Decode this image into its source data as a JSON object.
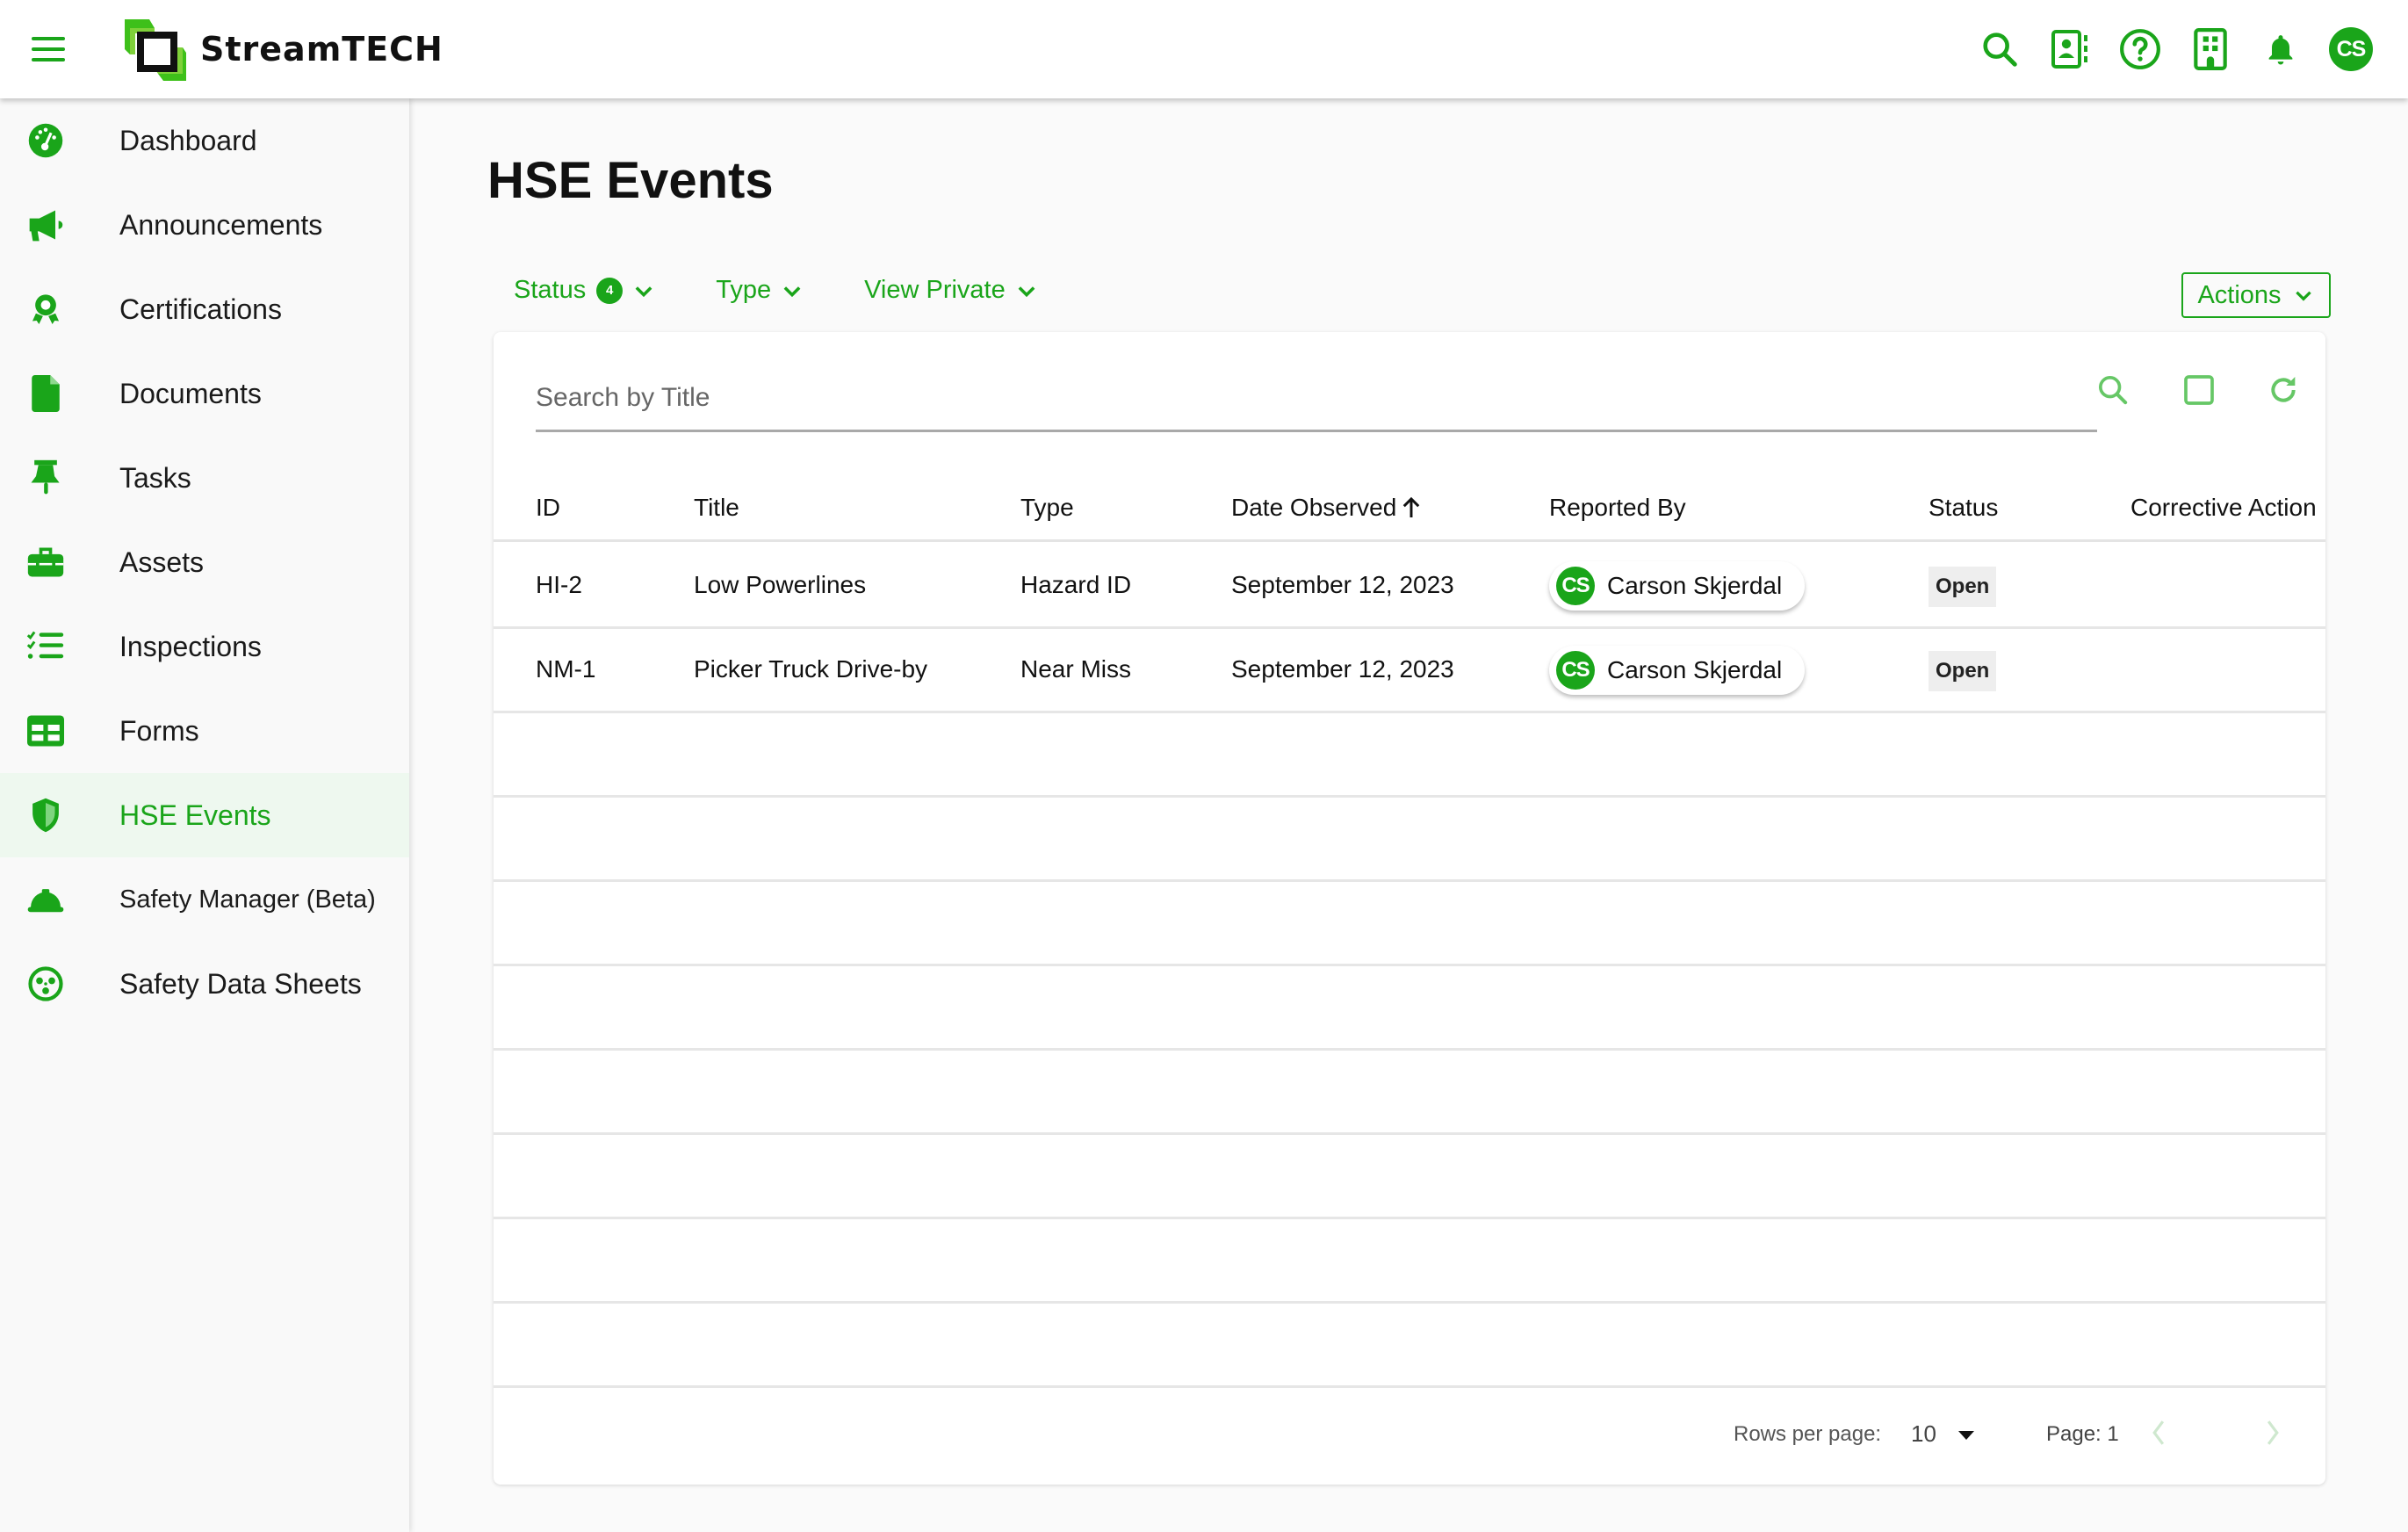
{
  "app": {
    "brand": "StreamTECH",
    "brand_color": "#1aa51a",
    "top_icons": [
      "search-icon",
      "contacts-icon",
      "help-icon",
      "building-icon",
      "bell-icon"
    ],
    "user_initials": "CS"
  },
  "sidebar": {
    "items": [
      {
        "label": "Dashboard",
        "icon": "dashboard-icon",
        "active": false
      },
      {
        "label": "Announcements",
        "icon": "megaphone-icon",
        "active": false
      },
      {
        "label": "Certifications",
        "icon": "award-icon",
        "active": false
      },
      {
        "label": "Documents",
        "icon": "document-icon",
        "active": false
      },
      {
        "label": "Tasks",
        "icon": "pin-icon",
        "active": false
      },
      {
        "label": "Assets",
        "icon": "toolbox-icon",
        "active": false
      },
      {
        "label": "Inspections",
        "icon": "checklist-icon",
        "active": false
      },
      {
        "label": "Forms",
        "icon": "table-icon",
        "active": false
      },
      {
        "label": "HSE Events",
        "icon": "shield-icon",
        "active": true
      },
      {
        "label": "Safety Manager (Beta)",
        "icon": "hardhat-icon",
        "active": false
      },
      {
        "label": "Safety Data Sheets",
        "icon": "biohazard-icon",
        "active": false
      }
    ]
  },
  "main": {
    "title": "HSE Events",
    "filters": {
      "status_label": "Status",
      "status_count": "4",
      "type_label": "Type",
      "private_label": "View Private"
    },
    "actions_label": "Actions",
    "search": {
      "placeholder": "Search by Title",
      "value": ""
    },
    "table": {
      "columns": [
        "ID",
        "Title",
        "Type",
        "Date Observed",
        "Reported By",
        "Status",
        "Corrective Action"
      ],
      "sort_column": "Date Observed",
      "sort_direction": "ascending",
      "rows": [
        {
          "id": "HI-2",
          "title": "Low Powerlines",
          "type": "Hazard ID",
          "date": "September 12, 2023",
          "reporter_initials": "CS",
          "reporter": "Carson Skjerdal",
          "status": "Open",
          "corrective_action": ""
        },
        {
          "id": "NM-1",
          "title": "Picker Truck Drive-by",
          "type": "Near Miss",
          "date": "September 12, 2023",
          "reporter_initials": "CS",
          "reporter": "Carson Skjerdal",
          "status": "Open",
          "corrective_action": ""
        }
      ],
      "empty_rows": 8
    },
    "pagination": {
      "rows_per_page_label": "Rows per page:",
      "rows_per_page": "10",
      "page_label": "Page: 1"
    }
  }
}
